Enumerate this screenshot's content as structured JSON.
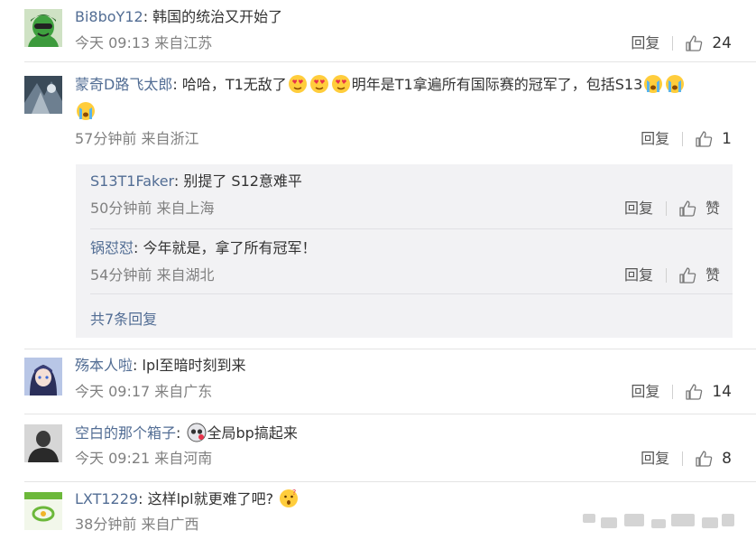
{
  "comments": [
    {
      "user": "Bi8boY12",
      "text": "韩国的统治又开始了",
      "meta": "今天 09:13 来自江苏",
      "reply_label": "回复",
      "likes": "24"
    },
    {
      "user": "蒙奇D路飞太郎",
      "text_a": "哈哈，T1无敌了",
      "text_b": "明年是T1拿遍所有国际赛的冠军了，包括S13",
      "meta": "57分钟前 来自浙江",
      "reply_label": "回复",
      "likes": "1",
      "sub_replies": [
        {
          "user": "S13T1Faker",
          "text": "别提了 S12意难平",
          "meta": "50分钟前 来自上海",
          "reply_label": "回复",
          "like_label": "赞"
        },
        {
          "user": "锅怼怼",
          "text": "今年就是，拿了所有冠军！",
          "meta": "54分钟前 来自湖北",
          "reply_label": "回复",
          "like_label": "赞"
        }
      ],
      "more_replies": "共7条回复"
    },
    {
      "user": "殇本人啦",
      "text": "lpl至暗时刻到来",
      "meta": "今天 09:17 来自广东",
      "reply_label": "回复",
      "likes": "14"
    },
    {
      "user": "空白的那个箱子",
      "text": "全局bp搞起来",
      "meta": "今天 09:21 来自河南",
      "reply_label": "回复",
      "likes": "8"
    },
    {
      "user": "LXT1229",
      "text": "这样lpl就更难了吧?",
      "meta": "38分钟前 来自广西"
    }
  ],
  "colon": ":",
  "icons": {
    "like": "thumbs-up-icon",
    "emoji_love": "heart-eyes-emoji",
    "emoji_cry": "crying-emoji",
    "emoji_skull": "skull-emoji",
    "emoji_think": "thinking-emoji"
  },
  "colors": {
    "username": "#526d94",
    "meta": "#808080",
    "subbox": "#f2f2f4"
  }
}
